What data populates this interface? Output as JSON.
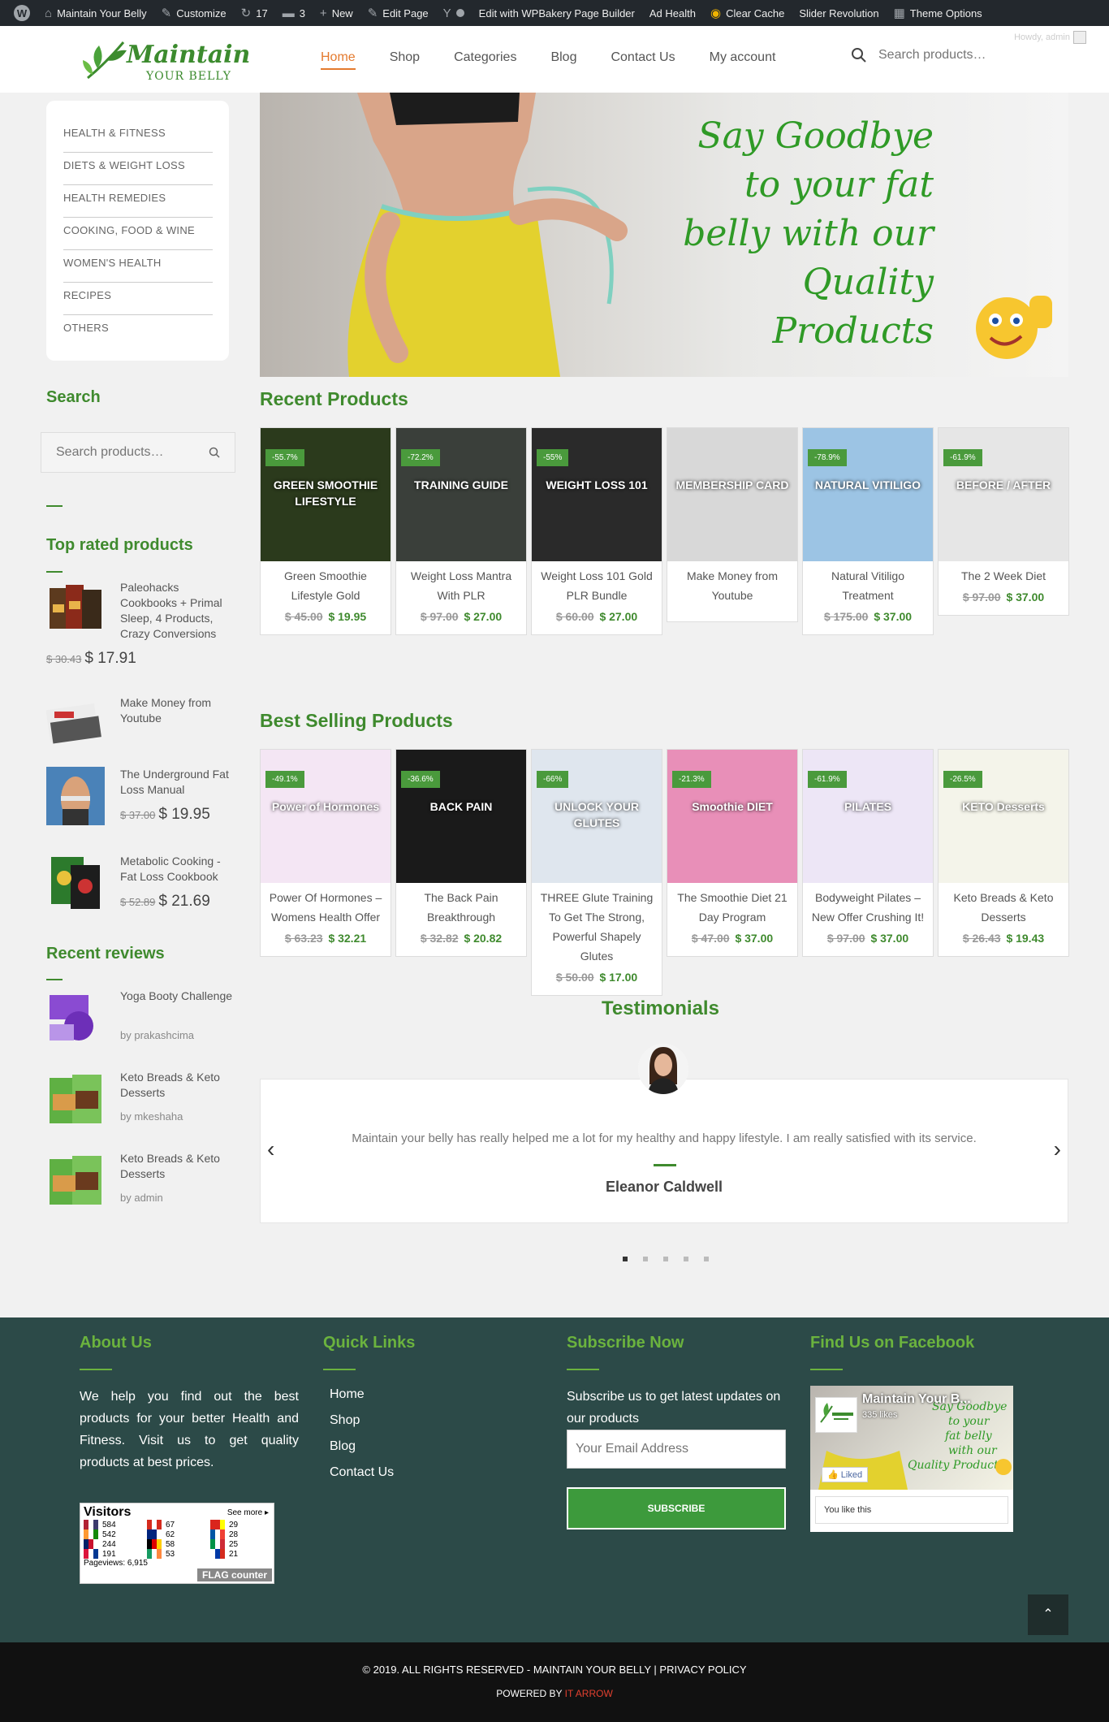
{
  "adminbar": {
    "site": "Maintain Your Belly",
    "customize": "Customize",
    "updates": "17",
    "comments": "3",
    "new": "New",
    "edit_page": "Edit Page",
    "wpbakery": "Edit with WPBakery Page Builder",
    "ad_health": "Ad Health",
    "clear_cache": "Clear Cache",
    "slider": "Slider Revolution",
    "theme_options": "Theme Options",
    "howdy": "Howdy, admin"
  },
  "logo": {
    "line1": "Maintain",
    "line2": "YOUR BELLY"
  },
  "nav": [
    "Home",
    "Shop",
    "Categories",
    "Blog",
    "Contact Us",
    "My account"
  ],
  "search": {
    "placeholder": "Search products…"
  },
  "categories": [
    "HEALTH & FITNESS",
    "DIETS & WEIGHT LOSS",
    "HEALTH REMEDIES",
    "COOKING, FOOD & WINE",
    "WOMEN'S HEALTH",
    "RECIPES",
    "OTHERS"
  ],
  "sidebar": {
    "search_title": "Search",
    "search_placeholder": "Search products…",
    "top_rated_title": "Top rated products",
    "top_rated": [
      {
        "name": "Paleohacks Cookbooks + Primal Sleep, 4 Products, Crazy Conversions",
        "old": "$ 30.43",
        "price": "$ 17.91"
      },
      {
        "name": "Make Money from Youtube",
        "old": "",
        "price": ""
      },
      {
        "name": "The Underground Fat Loss Manual",
        "old": "$ 37.00",
        "price": "$ 19.95"
      },
      {
        "name": "Metabolic Cooking - Fat Loss Cookbook",
        "old": "$ 52.89",
        "price": "$ 21.69"
      }
    ],
    "reviews_title": "Recent reviews",
    "reviews": [
      {
        "name": "Yoga Booty Challenge",
        "by": "by prakashcima"
      },
      {
        "name": "Keto Breads & Keto Desserts",
        "by": "by mkeshaha"
      },
      {
        "name": "Keto Breads & Keto Desserts",
        "by": "by admin"
      }
    ]
  },
  "hero": {
    "text": "Say Goodbye to your fat belly with our Quality Products"
  },
  "recent": {
    "title": "Recent Products",
    "items": [
      {
        "name": "Green Smoothie Lifestyle Gold",
        "badge": "-55.7%",
        "old": "$ 45.00",
        "price": "$ 19.95",
        "cover": "GREEN SMOOTHIE LIFESTYLE",
        "bg": "#2b3a1c"
      },
      {
        "name": "Weight Loss Mantra With PLR",
        "badge": "-72.2%",
        "old": "$ 97.00",
        "price": "$ 27.00",
        "cover": "TRAINING GUIDE",
        "bg": "#3a3f3a"
      },
      {
        "name": "Weight Loss 101 Gold PLR Bundle",
        "badge": "-55%",
        "old": "$ 60.00",
        "price": "$ 27.00",
        "cover": "WEIGHT LOSS 101",
        "bg": "#2a2a2a"
      },
      {
        "name": "Make Money from Youtube",
        "badge": "",
        "old": "",
        "price": "",
        "cover": "MEMBERSHIP CARD",
        "bg": "#d8d8d8"
      },
      {
        "name": "Natural Vitiligo Treatment",
        "badge": "-78.9%",
        "old": "$ 175.00",
        "price": "$ 37.00",
        "cover": "NATURAL VITILIGO",
        "bg": "#9cc4e4"
      },
      {
        "name": "The 2 Week Diet",
        "badge": "-61.9%",
        "old": "$ 97.00",
        "price": "$ 37.00",
        "cover": "BEFORE / AFTER",
        "bg": "#e6e6e6"
      }
    ]
  },
  "best": {
    "title": "Best Selling Products",
    "items": [
      {
        "name": "Power Of Hormones – Womens Health Offer",
        "badge": "-49.1%",
        "old": "$ 63.23",
        "price": "$ 32.21",
        "cover": "Power of Hormones",
        "bg": "#f4e6f4"
      },
      {
        "name": "The Back Pain Breakthrough",
        "badge": "-36.6%",
        "old": "$ 32.82",
        "price": "$ 20.82",
        "cover": "BACK PAIN",
        "bg": "#1a1a1a"
      },
      {
        "name": "THREE Glute Training To Get The Strong, Powerful Shapely Glutes",
        "badge": "-66%",
        "old": "$ 50.00",
        "price": "$ 17.00",
        "cover": "UNLOCK YOUR GLUTES",
        "bg": "#dfe6ee"
      },
      {
        "name": "The Smoothie Diet 21 Day Program",
        "badge": "-21.3%",
        "old": "$ 47.00",
        "price": "$ 37.00",
        "cover": "Smoothie DIET",
        "bg": "#e88fb8"
      },
      {
        "name": "Bodyweight Pilates – New Offer Crushing It!",
        "badge": "-61.9%",
        "old": "$ 97.00",
        "price": "$ 37.00",
        "cover": "PILATES",
        "bg": "#ede6f6"
      },
      {
        "name": "Keto Breads & Keto Desserts",
        "badge": "-26.5%",
        "old": "$ 26.43",
        "price": "$ 19.43",
        "cover": "KETO Desserts",
        "bg": "#f4f4ea"
      }
    ]
  },
  "testimonials": {
    "title": "Testimonials",
    "quote": "Maintain your belly has really helped me a lot for my healthy and happy lifestyle. I am really satisfied with its service.",
    "name": "Eleanor Caldwell"
  },
  "footer": {
    "about_title": "About Us",
    "about_text": "We help you find out the best products for your better Health and Fitness. Visit us to get quality products at best prices.",
    "links_title": "Quick Links",
    "links": [
      "Home",
      "Shop",
      "Blog",
      "Contact Us"
    ],
    "subscribe_title": "Subscribe Now",
    "subscribe_text": "Subscribe us to get latest updates on our products",
    "email_placeholder": "Your Email Address",
    "subscribe_btn": "SUBSCRIBE",
    "fb_title": "Find Us on Facebook",
    "fb_name": "Maintain Your B...",
    "fb_likes": "335 likes",
    "fb_liked": "Liked",
    "fb_you": "You like this",
    "visitors": {
      "title": "Visitors",
      "see_more": "See more",
      "rows": [
        {
          "flag": "us",
          "count": "584"
        },
        {
          "flag": "ca",
          "count": "67"
        },
        {
          "flag": "vn",
          "count": "29"
        },
        {
          "flag": "in",
          "count": "542"
        },
        {
          "flag": "au",
          "count": "62"
        },
        {
          "flag": "fr",
          "count": "28"
        },
        {
          "flag": "gb",
          "count": "244"
        },
        {
          "flag": "de",
          "count": "58"
        },
        {
          "flag": "it",
          "count": "25"
        },
        {
          "flag": "np",
          "count": "191"
        },
        {
          "flag": "ie",
          "count": "53"
        },
        {
          "flag": "ru",
          "count": "21"
        }
      ],
      "pageviews": "Pageviews: 6,915",
      "brand": "FLAG counter"
    },
    "copyright": "© 2019. ALL RIGHTS RESERVED - MAINTAIN YOUR BELLY | PRIVACY POLICY",
    "powered": "POWERED BY",
    "powered_by": "IT ARROW"
  }
}
